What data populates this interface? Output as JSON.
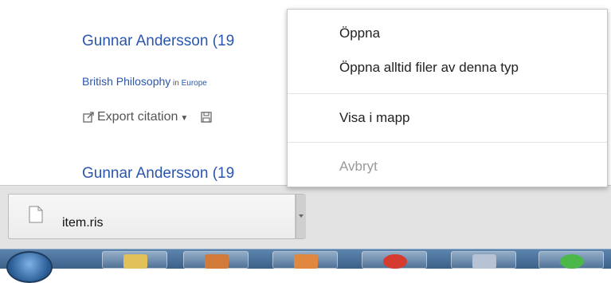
{
  "page": {
    "result_title_1": "Gunnar Andersson (19",
    "source_journal": "British Philosophy",
    "source_in": " in ",
    "source_collection": "Europe",
    "export_label": "Export citation",
    "result_title_2": "Gunnar Andersson (19"
  },
  "download_shelf": {
    "file_name": "item.ris"
  },
  "context_menu": {
    "items": [
      {
        "label": "Öppna"
      },
      {
        "label": "Öppna alltid filer av denna typ"
      },
      {
        "label": "Visa i mapp"
      },
      {
        "label": "Avbryt",
        "disabled": true
      }
    ]
  },
  "taskbar": {
    "apps": [
      "file-explorer-icon",
      "media-icon",
      "paint-icon",
      "chrome-icon",
      "document-icon",
      "green-app-icon"
    ]
  },
  "colors": {
    "link": "#2a56b0",
    "menu_text": "#222222",
    "menu_disabled": "#9a9a9a",
    "shelf_bg": "#e3e3e3"
  }
}
